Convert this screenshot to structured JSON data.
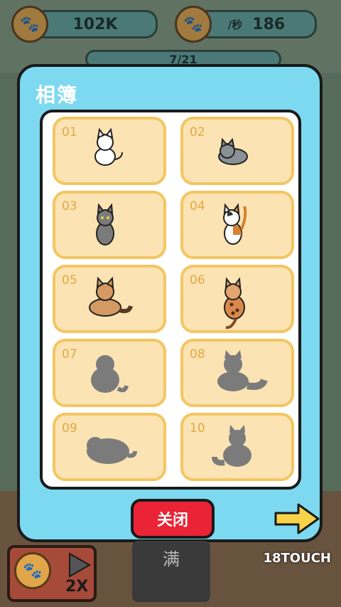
{
  "hud": {
    "coins": "102K",
    "rate_suffix": "/秒",
    "rate": "186",
    "counter": "7/21"
  },
  "modal": {
    "title": "相簿",
    "close_label": "关闭",
    "slots": [
      {
        "num": "01",
        "status": "unlocked",
        "cat": "white"
      },
      {
        "num": "02",
        "status": "unlocked",
        "cat": "grey-loaf"
      },
      {
        "num": "03",
        "status": "unlocked",
        "cat": "grey-tabby"
      },
      {
        "num": "04",
        "status": "unlocked",
        "cat": "calico"
      },
      {
        "num": "05",
        "status": "unlocked",
        "cat": "orange-longhair"
      },
      {
        "num": "06",
        "status": "unlocked",
        "cat": "bengal"
      },
      {
        "num": "07",
        "status": "locked",
        "cat": "silhouette"
      },
      {
        "num": "08",
        "status": "locked",
        "cat": "silhouette"
      },
      {
        "num": "09",
        "status": "locked",
        "cat": "silhouette"
      },
      {
        "num": "10",
        "status": "locked",
        "cat": "silhouette"
      }
    ]
  },
  "bottom": {
    "speed_label": "2X",
    "full_label": "满",
    "watermark": "18TOUCH"
  },
  "colors": {
    "modal_bg": "#7dd9ef",
    "slot_bg": "#fbe3b3",
    "slot_border": "#f2c662",
    "close_button": "#ea2436",
    "arrow": "#f7d34a"
  },
  "icons": [
    "paw-coin-icon",
    "next-arrow-icon",
    "cat-icon",
    "cat-silhouette-icon",
    "play-icon"
  ]
}
